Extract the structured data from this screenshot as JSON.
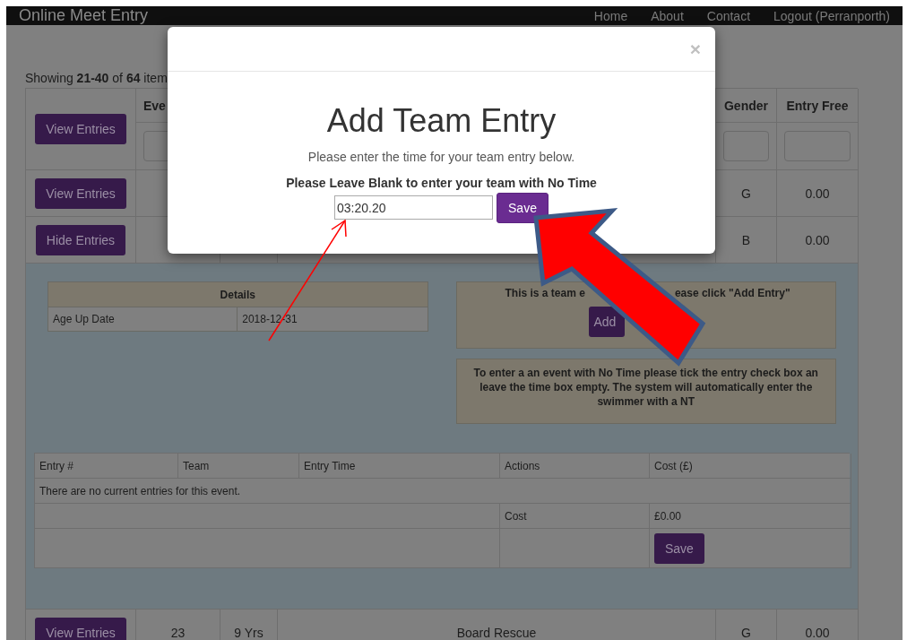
{
  "navbar": {
    "brand": "Online Meet Entry",
    "links": [
      "Home",
      "About",
      "Contact",
      "Logout (Perranporth)"
    ]
  },
  "summary": "Showing **21-40** of **64** item",
  "table": {
    "header_button": "View Entries",
    "column_2": "Eve",
    "gender": "Gender",
    "entry_free": "Entry Free",
    "rows": [
      {
        "button": "View Entries",
        "gender": "G",
        "fee": "0.00"
      },
      {
        "button": "Hide Entries",
        "gender": "B",
        "fee": "0.00",
        "panel": {
          "details": {
            "heading": "Details",
            "rows": [
              {
                "label": "Age Up Date",
                "value": "2018-12-31"
              }
            ]
          },
          "notice": {
            "text_before": "This is a team e",
            "text_after": "ease click \"Add Entry\"",
            "button": "Add"
          },
          "no_time_note": "To enter a an event with No Time please tick the entry check box an leave the time box empty. The system will automatically enter the swimmer with a NT",
          "entries": {
            "columns": [
              "Entry #",
              "Team",
              "Entry Time",
              "Actions",
              "Cost (£)"
            ],
            "empty_message": "There are no current entries for this event.",
            "cost_label": "Cost",
            "cost_value": "£0.00",
            "save": "Save"
          }
        }
      },
      {
        "button": "View Entries",
        "number": "23",
        "age": "9 Yrs",
        "event": "Board Rescue",
        "gender": "G",
        "fee": "0.00"
      }
    ]
  },
  "modal": {
    "close": "×",
    "title": "Add Team Entry",
    "subtitle": "Please enter the time for your team entry below.",
    "instruction": "Please Leave Blank to enter your team with No Time",
    "time_value": "03:20.20",
    "save": "Save"
  }
}
